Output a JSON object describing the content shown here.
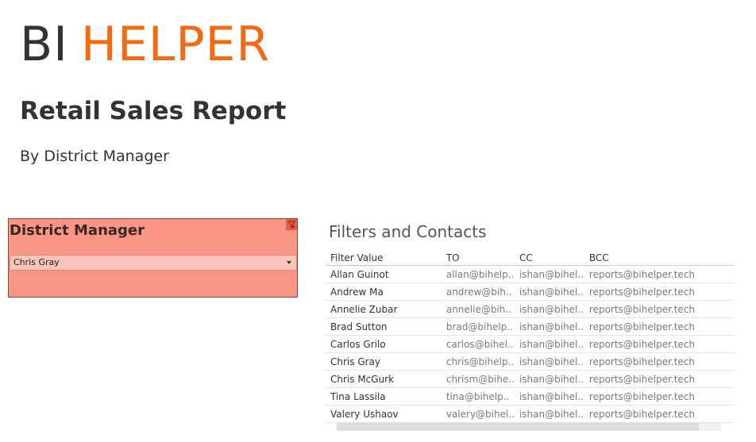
{
  "brand": {
    "part1": "BI",
    "part2": "HELPER"
  },
  "report": {
    "title": "Retail Sales Report",
    "subtitle": "By District Manager"
  },
  "filter": {
    "title": "District Manager",
    "selected": "Chris Gray"
  },
  "contacts": {
    "title": "Filters and Contacts",
    "headers": [
      "Filter Value",
      "TO",
      "CC",
      "BCC"
    ],
    "rows": [
      [
        "Allan Guinot",
        "allan@bihelp..",
        "ishan@bihel..",
        "reports@bihelper.tech"
      ],
      [
        "Andrew Ma",
        "andrew@bih..",
        "ishan@bihel..",
        "reports@bihelper.tech"
      ],
      [
        "Annelie Zubar",
        "annelie@bih..",
        "ishan@bihel..",
        "reports@bihelper.tech"
      ],
      [
        "Brad Sutton",
        "brad@bihelp..",
        "ishan@bihel..",
        "reports@bihelper.tech"
      ],
      [
        "Carlos Grilo",
        "carlos@bihel..",
        "ishan@bihel..",
        "reports@bihelper.tech"
      ],
      [
        "Chris Gray",
        "chris@bihelp..",
        "ishan@bihel..",
        "reports@bihelper.tech"
      ],
      [
        "Chris McGurk",
        "chrism@bihe..",
        "ishan@bihel..",
        "reports@bihelper.tech"
      ],
      [
        "Tina Lassila",
        "tina@bihelp..",
        "ishan@bihel..",
        "reports@bihelper.tech"
      ],
      [
        "Valery Ushaov",
        "valery@bihel..",
        "ishan@bihel..",
        "reports@bihelper.tech"
      ]
    ]
  },
  "colors": {
    "brand_orange": "#f36a12",
    "filter_bg": "#f99585",
    "dropdown_bg": "#fbc3b9"
  },
  "icons": {
    "filter": "filter-clear-icon",
    "dropdown": "chevron-down-icon"
  }
}
